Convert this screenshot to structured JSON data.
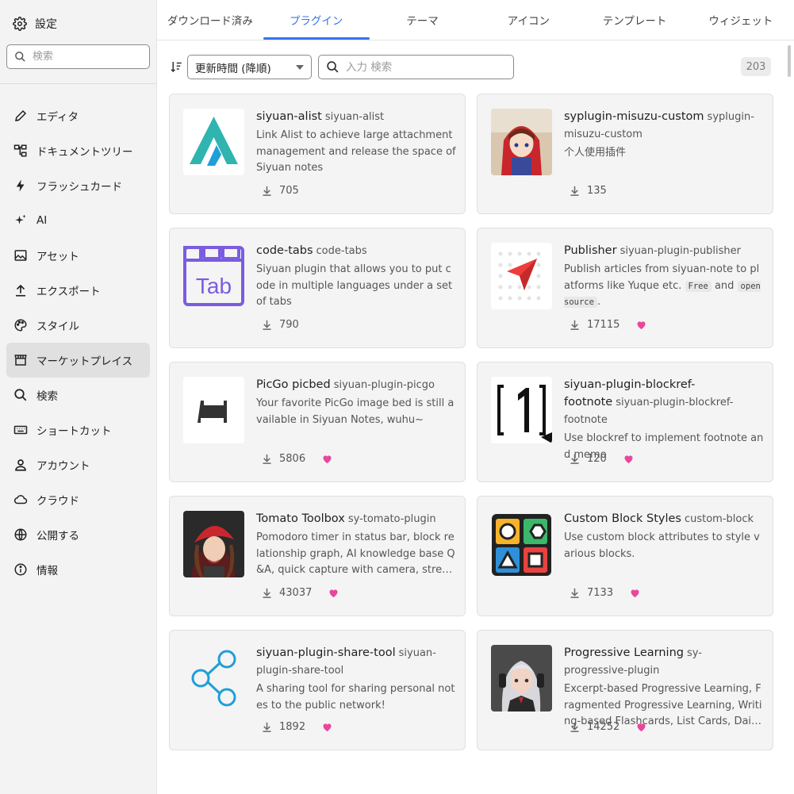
{
  "sidebar": {
    "title": "設定",
    "search_placeholder": "検索",
    "items": [
      {
        "label": "エディタ",
        "icon": "pencil-icon"
      },
      {
        "label": "ドキュメントツリー",
        "icon": "tree-icon"
      },
      {
        "label": "フラッシュカード",
        "icon": "flash-icon"
      },
      {
        "label": "AI",
        "icon": "sparkle-icon"
      },
      {
        "label": "アセット",
        "icon": "image-icon"
      },
      {
        "label": "エクスポート",
        "icon": "upload-icon"
      },
      {
        "label": "スタイル",
        "icon": "palette-icon"
      },
      {
        "label": "マーケットプレイス",
        "icon": "store-icon"
      },
      {
        "label": "検索",
        "icon": "search-icon"
      },
      {
        "label": "ショートカット",
        "icon": "keyboard-icon"
      },
      {
        "label": "アカウント",
        "icon": "account-icon"
      },
      {
        "label": "クラウド",
        "icon": "cloud-icon"
      },
      {
        "label": "公開する",
        "icon": "globe-icon"
      },
      {
        "label": "情報",
        "icon": "info-icon"
      }
    ],
    "active_index": 7
  },
  "tabs": [
    "ダウンロード済み",
    "プラグイン",
    "テーマ",
    "アイコン",
    "テンプレート",
    "ウィジェット"
  ],
  "active_tab": 1,
  "toolbar": {
    "sort_value": "更新時間 (降順)",
    "search_placeholder": "入力 検索",
    "count": "203"
  },
  "plugins": [
    {
      "name": "siyuan-alist",
      "package": "siyuan-alist",
      "description": "Link Alist to achieve large attachment management and release the space of Siyuan notes",
      "downloads": "705",
      "liked": false,
      "thumb": "alist-logo"
    },
    {
      "name": "syplugin-misuzu-custom",
      "package": "syplugin-misuzu-custom",
      "description": "个人使用插件",
      "downloads": "135",
      "liked": false,
      "thumb": "anime-girl-red-hood"
    },
    {
      "name": "code-tabs",
      "package": "code-tabs",
      "description": "Siyuan plugin that allows you to put code in multiple languages under a set of tabs",
      "downloads": "790",
      "liked": false,
      "thumb": "tab-logo"
    },
    {
      "name": "Publisher",
      "package": "siyuan-plugin-publisher",
      "description_parts": [
        "Publish articles from siyuan-note to platforms like Yuque etc. ",
        "Free",
        " and ",
        "open source",
        "."
      ],
      "downloads": "17115",
      "liked": true,
      "thumb": "paper-plane-logo"
    },
    {
      "name": "PicGo picbed",
      "package": "siyuan-plugin-picgo",
      "description": "Your favorite PicGo image bed is still available in Siyuan Notes, wuhu~",
      "downloads": "5806",
      "liked": true,
      "thumb": "bed-icon"
    },
    {
      "name": "siyuan-plugin-blockref-footnote",
      "package": "siyuan-plugin-blockref-footnote",
      "description": "Use blockref to implement footnote and memo",
      "downloads": "120",
      "liked": true,
      "thumb": "footnote-logo"
    },
    {
      "name": "Tomato Toolbox",
      "package": "sy-tomato-plugin",
      "description": "Pomodoro timer in status bar, block relationship graph, AI knowledge base Q&A, quick capture with camera, streaming...",
      "downloads": "43037",
      "liked": true,
      "thumb": "girl-red-cap"
    },
    {
      "name": "Custom Block Styles",
      "package": "custom-block",
      "description": "Use custom block attributes to style various blocks.",
      "downloads": "7133",
      "liked": true,
      "thumb": "shapes-logo"
    },
    {
      "name": "siyuan-plugin-share-tool",
      "package": "siyuan-plugin-share-tool",
      "description": "A sharing tool for sharing personal notes to the public network!",
      "downloads": "1892",
      "liked": true,
      "thumb": "share-icon"
    },
    {
      "name": "Progressive Learning",
      "package": "sy-progressive-plugin",
      "description": "Excerpt-based Progressive Learning, Fragmented Progressive Learning, Writing-based Flashcards, List Cards, Daily ...",
      "downloads": "14252",
      "liked": true,
      "thumb": "girl-headphones"
    }
  ],
  "colors": {
    "accent": "#3575f0",
    "heart": "#e8479b",
    "sidebar_bg": "#f3f3f3",
    "card_bg": "#f4f4f4"
  }
}
